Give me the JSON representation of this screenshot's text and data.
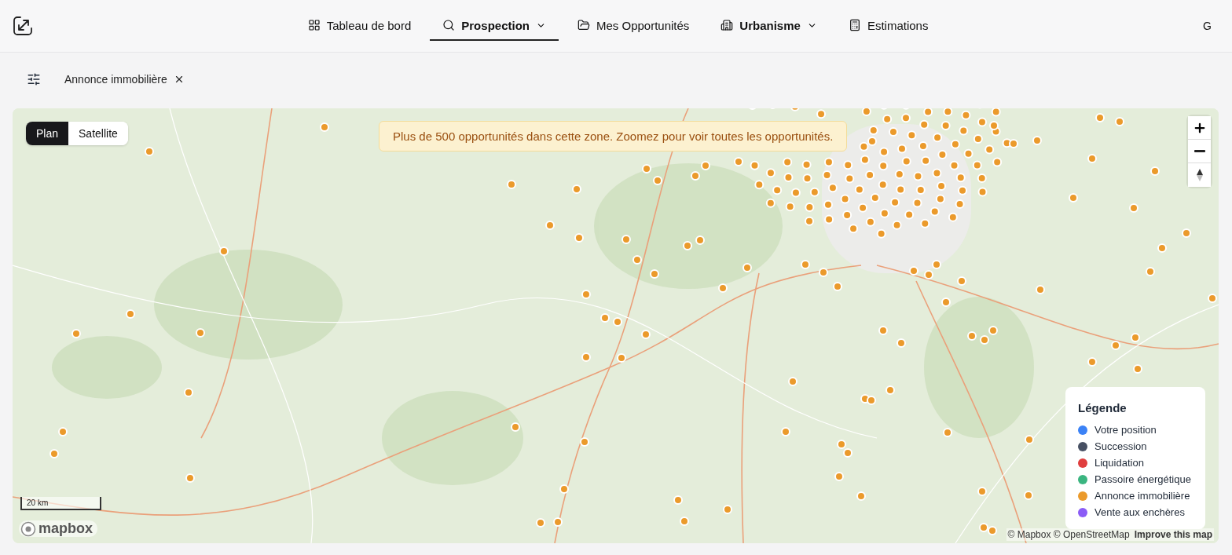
{
  "header": {
    "avatar": "G",
    "nav": [
      {
        "label": "Tableau de bord",
        "kind": "grid",
        "selected": false,
        "dropdown": false,
        "emphasized": false
      },
      {
        "label": "Prospection",
        "kind": "search",
        "selected": true,
        "dropdown": true,
        "emphasized": false
      },
      {
        "label": "Mes Opportunités",
        "kind": "folder",
        "selected": false,
        "dropdown": false,
        "emphasized": false
      },
      {
        "label": "Urbanisme",
        "kind": "building",
        "selected": false,
        "dropdown": true,
        "emphasized": true
      },
      {
        "label": "Estimations",
        "kind": "calculator",
        "selected": false,
        "dropdown": false,
        "emphasized": false
      }
    ]
  },
  "filters": {
    "chips": [
      {
        "label": "Annonce immobilière"
      }
    ]
  },
  "map": {
    "style_toggle": [
      {
        "label": "Plan",
        "selected": true
      },
      {
        "label": "Satellite",
        "selected": false
      }
    ],
    "notice": "Plus de 500 opportunités dans cette zone. Zoomez pour voir toutes les opportunités.",
    "legend": {
      "title": "Légende",
      "items": [
        {
          "label": "Votre position",
          "color": "#3b82f6"
        },
        {
          "label": "Succession",
          "color": "#475063"
        },
        {
          "label": "Liquidation",
          "color": "#e03e3e"
        },
        {
          "label": "Passoire énergétique",
          "color": "#3bb580"
        },
        {
          "label": "Annonce immobilière",
          "color": "#eb9a2b"
        },
        {
          "label": "Vente aux enchères",
          "color": "#8b5cf6"
        }
      ]
    },
    "scale": "20 km",
    "logo": "mapbox",
    "attribution": "© Mapbox © OpenStreetMap",
    "improve_link": "Improve this map"
  }
}
